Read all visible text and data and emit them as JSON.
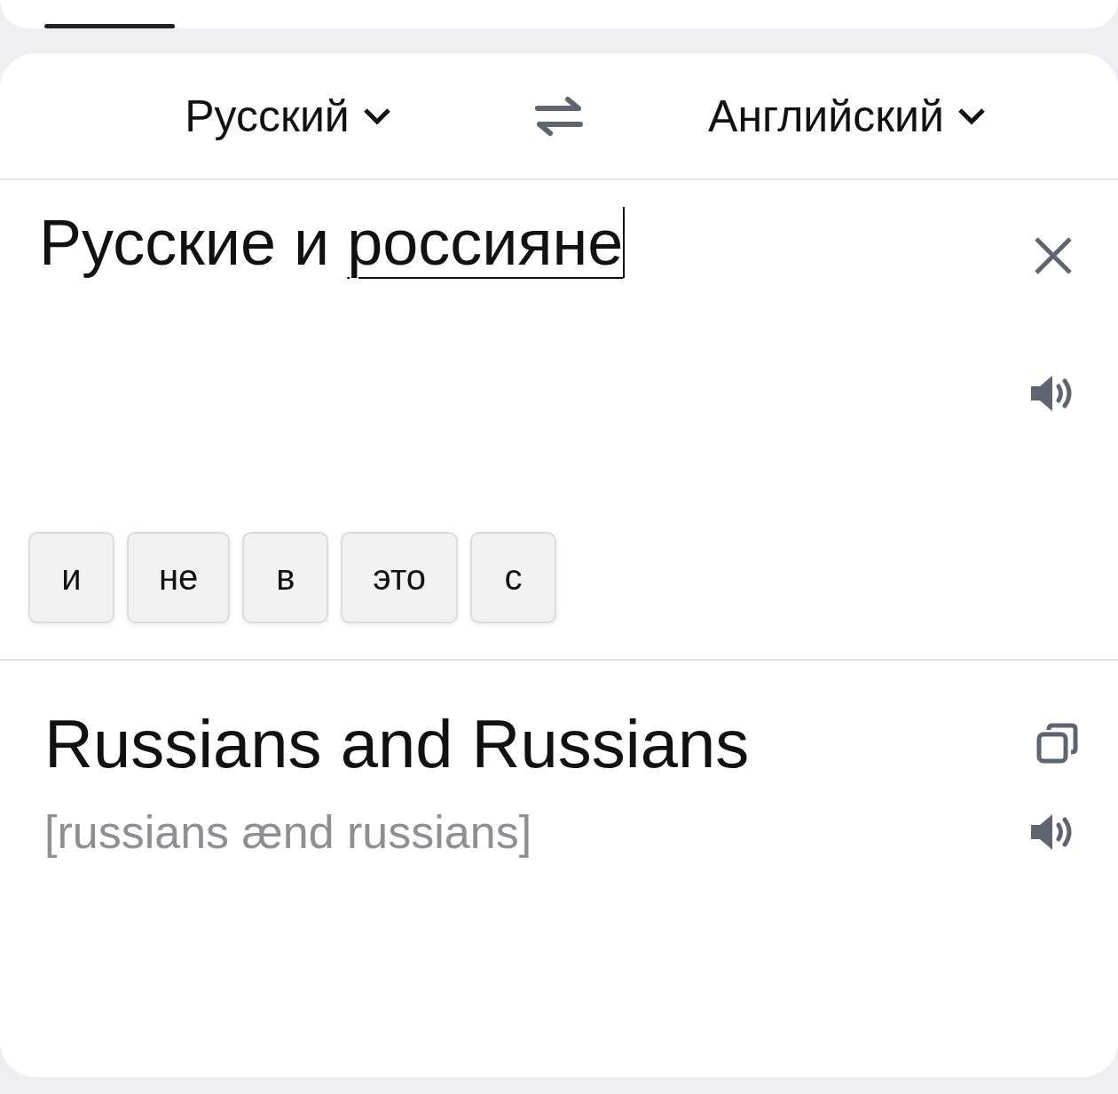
{
  "language_bar": {
    "source_language": "Русский",
    "target_language": "Английский"
  },
  "input": {
    "words": [
      {
        "text": "Русские",
        "composing": false
      },
      {
        "text": "и",
        "composing": false
      },
      {
        "text": "россияне",
        "composing": true
      }
    ]
  },
  "suggestions": [
    "и",
    "не",
    "в",
    "это",
    "с"
  ],
  "translation": {
    "text": "Russians and Russians",
    "transcription": "[russians ænd russians]"
  }
}
